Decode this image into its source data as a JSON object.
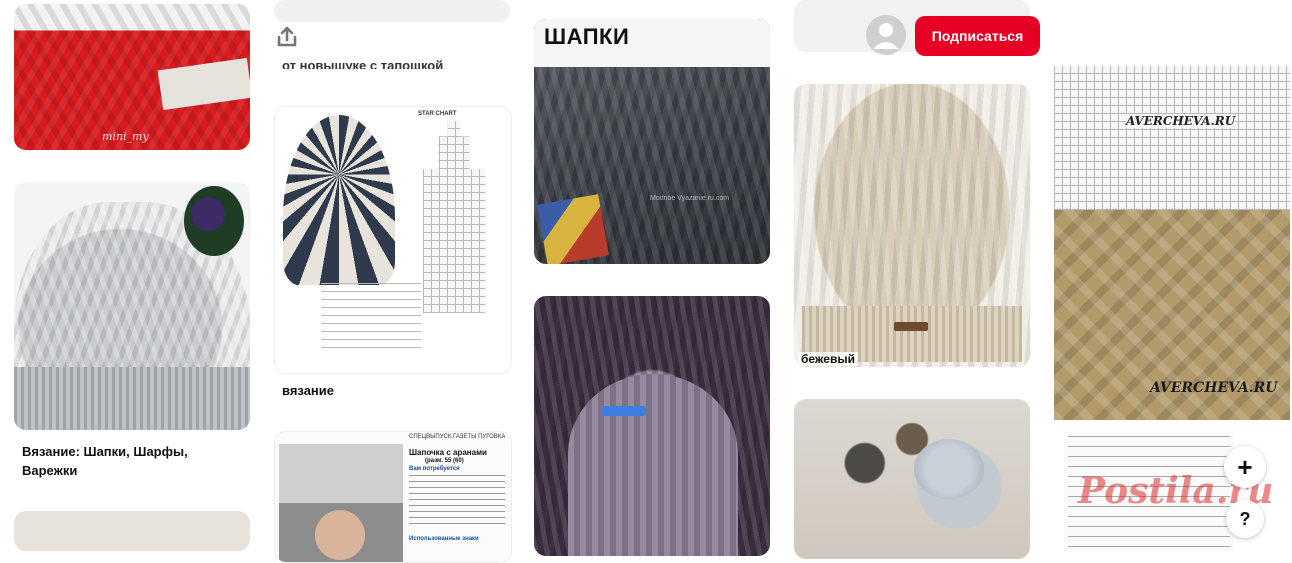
{
  "header": {
    "subscribe_label": "Подписаться",
    "accent_color": "#e60023"
  },
  "column1": {
    "pin1": {
      "watermark": "mini_my"
    },
    "pin2": {
      "title": "Вязание: Шапки, Шарфы, Варежки"
    }
  },
  "column2": {
    "pin1": {
      "title_partial": "от новышуке с тапошкой"
    },
    "pin2": {
      "chart_title": "STAR CHART",
      "title": "вязание"
    },
    "pin3": {
      "header_text": "СПЕЦВЫПУСК ГАЗЕТЫ ПУГОВКА",
      "book_title": "Шапочка с аранами",
      "size": "(разм. 55 (60)",
      "needs_heading": "Вам потребуется",
      "instructions_heading": "Использованные знаки"
    }
  },
  "column3": {
    "pin1": {
      "overlay_title": "ШАПКИ",
      "watermark": "Modnoe Vyazanie.ru.com"
    }
  },
  "column4": {
    "pin1": {
      "caption": "бежевый"
    }
  },
  "column5": {
    "pin1": {
      "watermark_top": "AVERCHEVA.RU",
      "watermark_bottom": "AVERCHEVA.RU",
      "site_logo": "Postila.ru"
    }
  },
  "controls": {
    "add_icon": "plus-icon",
    "help_icon": "question-icon",
    "share_icon": "share-icon",
    "avatar_icon": "avatar-icon",
    "plus_glyph": "+",
    "help_glyph": "?"
  }
}
